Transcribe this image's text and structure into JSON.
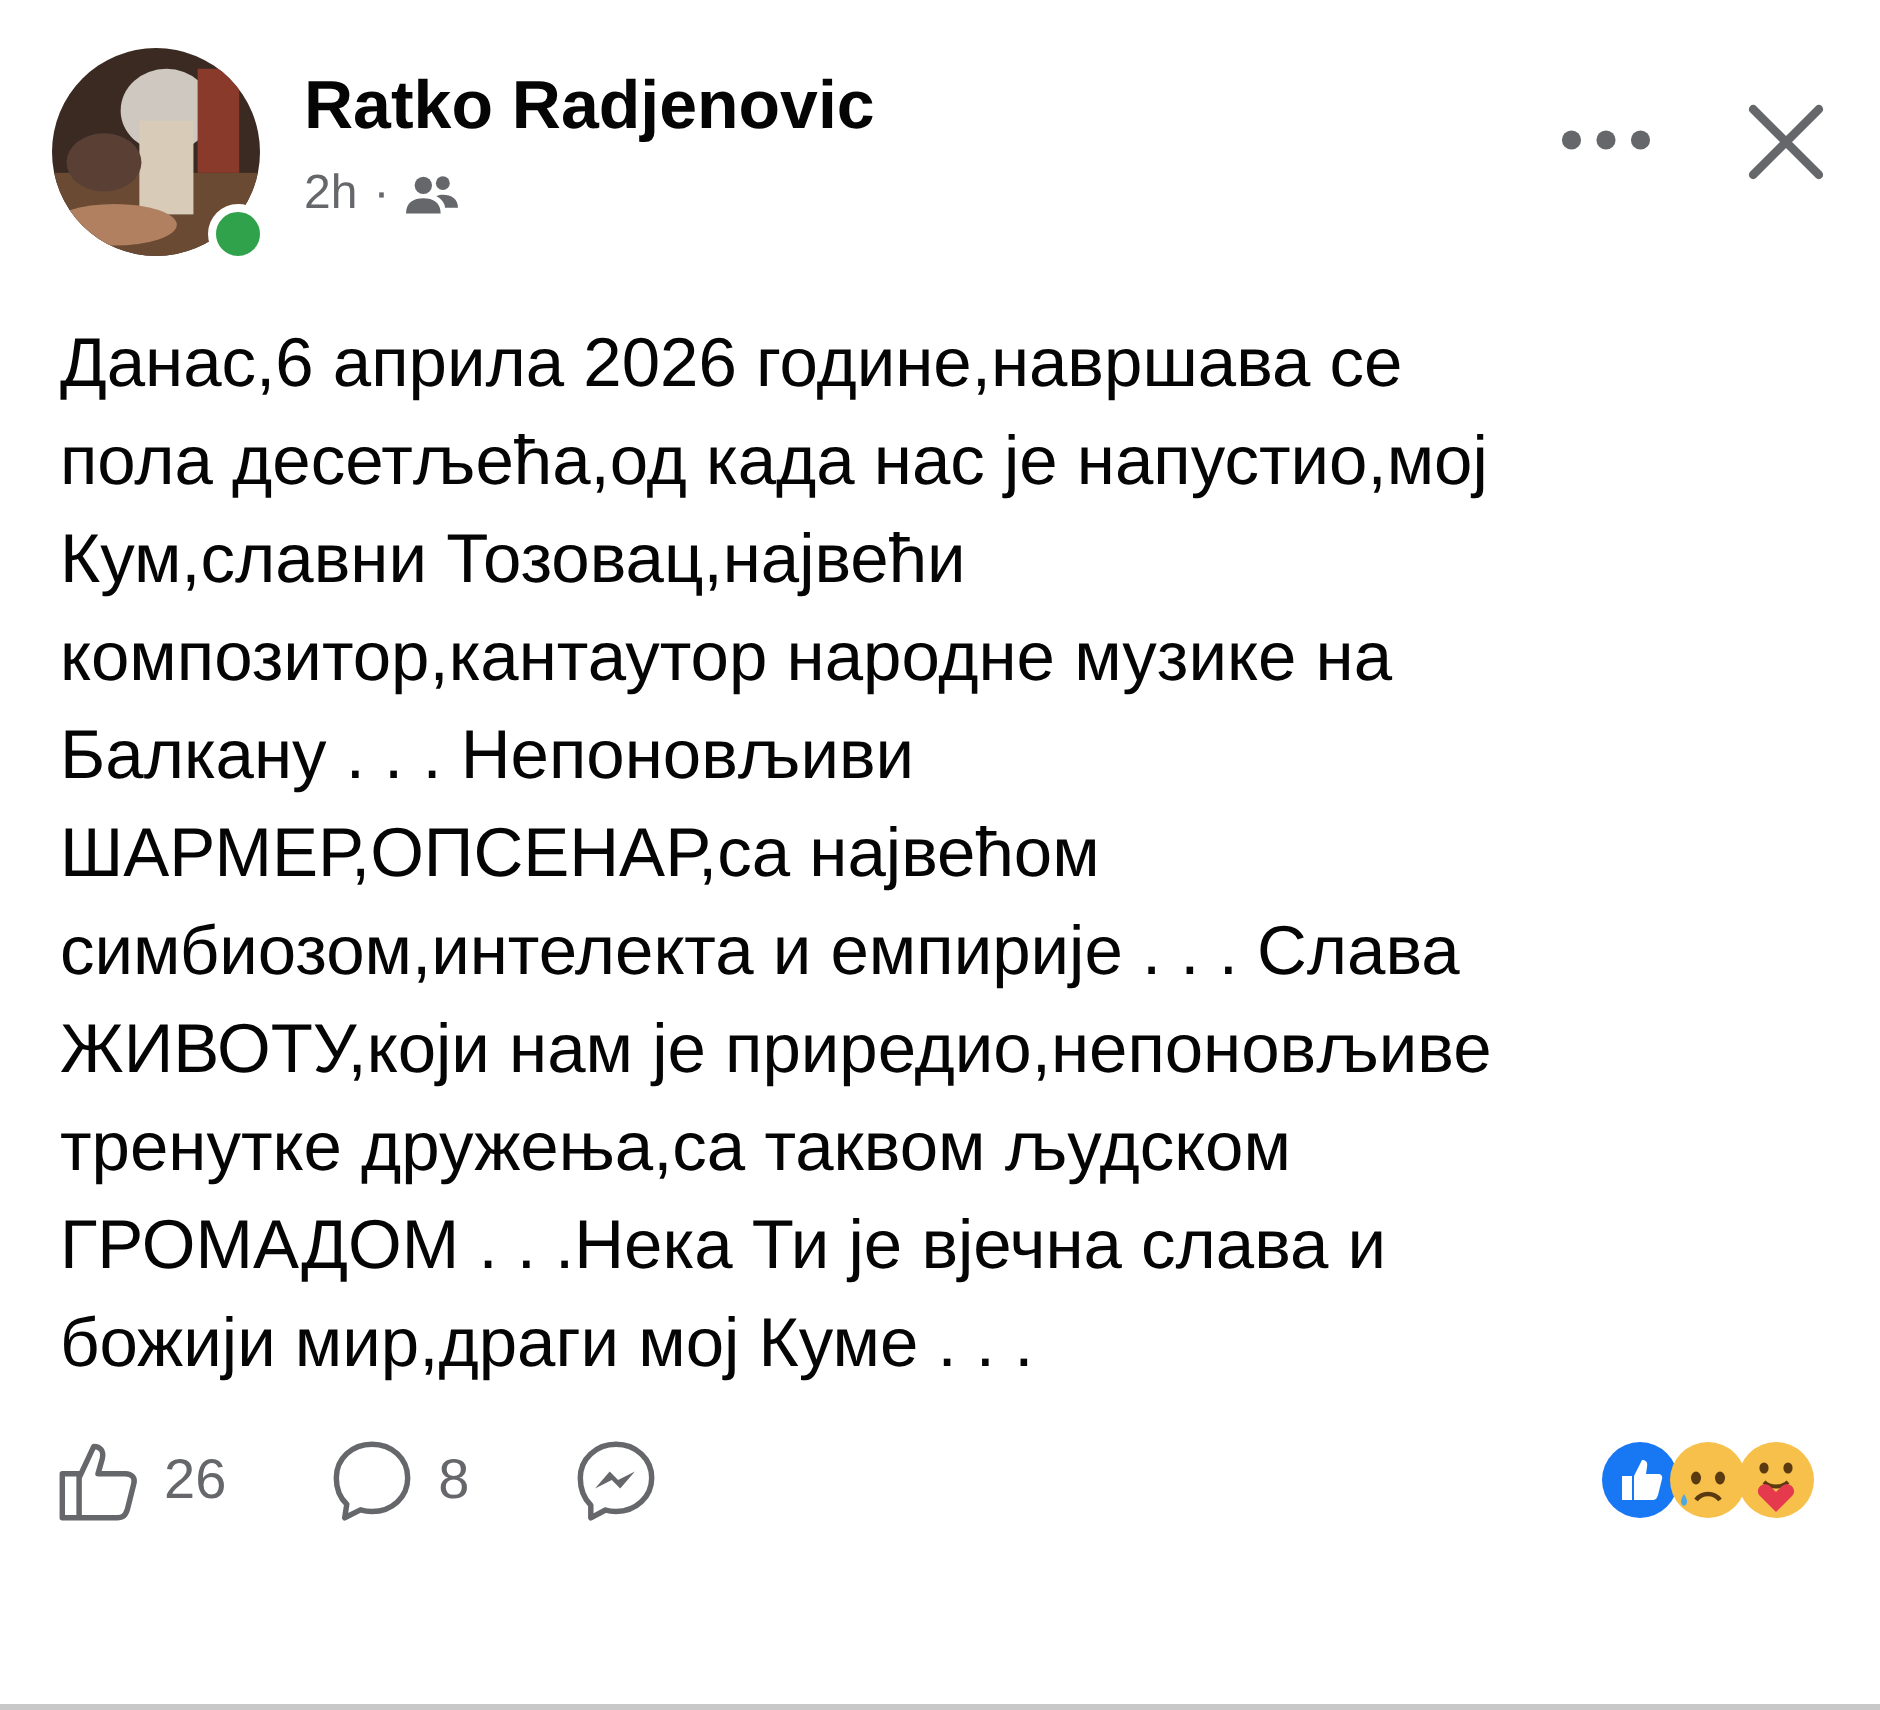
{
  "post": {
    "author": "Ratko Radjenovic",
    "online": true,
    "time": "2h",
    "separator": "·",
    "text": "Данас,6 априла 2026 године,навршава се\nпола десетљећа,од када нас је напустио,мој\nКум,славни Тозовац,највећи\nкомпозитор,кантаутор народне музике на\nБалкану . . . Непоновљиви\nШАРМЕР,ОПСЕНАР,са највећом\nсимбиозом,интелекта и емпирије . . . Слава\nЖИВОТУ,који нам је приредио,непоновљиве\nтренутке дружења,са таквом људском\nГРОМАДОМ . . .Нека Ти је вјечна слава и\nбожији мир,драги мој Куме . . ."
  },
  "actions": [
    {
      "kind": "like",
      "count": "26"
    },
    {
      "kind": "comment",
      "count": "8"
    },
    {
      "kind": "messenger"
    }
  ],
  "reactions": [
    {
      "kind": "like"
    },
    {
      "kind": "sad"
    },
    {
      "kind": "care"
    }
  ]
}
